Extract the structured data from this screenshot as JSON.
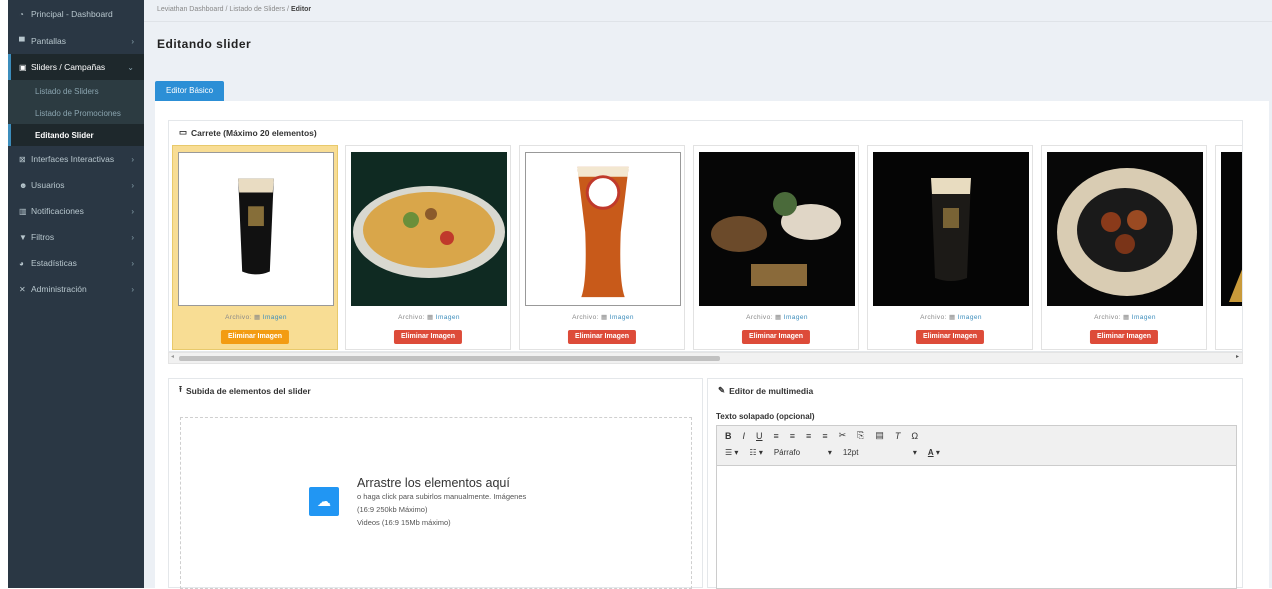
{
  "sidebar": {
    "items": [
      {
        "icon": "dashboard-icon",
        "label": "Principal - Dashboard",
        "arrow": ""
      },
      {
        "icon": "monitor-icon",
        "label": "Pantallas",
        "arrow": "›"
      },
      {
        "icon": "slider-icon",
        "label": "Sliders / Campañas",
        "arrow": "⌄"
      },
      {
        "icon": "interfaces-icon",
        "label": "Interfaces Interactivas",
        "arrow": "›"
      },
      {
        "icon": "users-icon",
        "label": "Usuarios",
        "arrow": "›"
      },
      {
        "icon": "bell-icon",
        "label": "Notificaciones",
        "arrow": "›"
      },
      {
        "icon": "filter-icon",
        "label": "Filtros",
        "arrow": "›"
      },
      {
        "icon": "chart-icon",
        "label": "Estadísticas",
        "arrow": "›"
      },
      {
        "icon": "admin-icon",
        "label": "Administración",
        "arrow": "›"
      }
    ],
    "sub": [
      "Listado de Sliders",
      "Listado de Promociones",
      "Editando Slider"
    ]
  },
  "breadcrumb": {
    "p1": "Leviathan Dashboard",
    "sep": "/",
    "p2": "Listado de Sliders",
    "p3": "Editor"
  },
  "page_title": "Editando slider",
  "tab": "Editor Básico",
  "carousel": {
    "title": "Carrete (Máximo 20 elementos)",
    "file_label": "Archivo:",
    "file_link": "Imagen",
    "delete_label": "Eliminar Imagen",
    "cards": [
      {
        "img": "guinness-pint",
        "selected": true
      },
      {
        "img": "nachos-plate",
        "selected": false
      },
      {
        "img": "red-beer-glass",
        "selected": false
      },
      {
        "img": "tapas-spread",
        "selected": false
      },
      {
        "img": "guinness-pint-dark",
        "selected": false
      },
      {
        "img": "meatball-pot",
        "selected": false
      }
    ]
  },
  "upload": {
    "title": "Subida de elementos del slider",
    "drop_title": "Arrastre los elementos aquí",
    "line1": "o haga click para subirlos manualmente. Imágenes",
    "line2": "(16:9 250kb Máximo)",
    "line3": "Videos (16:9 15Mb máximo)"
  },
  "media": {
    "title": "Editor de multimedia",
    "overlay_label": "Texto solapado (opcional)",
    "format": "Párrafo",
    "size": "12pt",
    "color": "A"
  },
  "colors": {
    "accent": "#2c8fd6",
    "danger": "#dd4b39",
    "warning": "#f39c12",
    "sidebar": "#2a3744"
  }
}
